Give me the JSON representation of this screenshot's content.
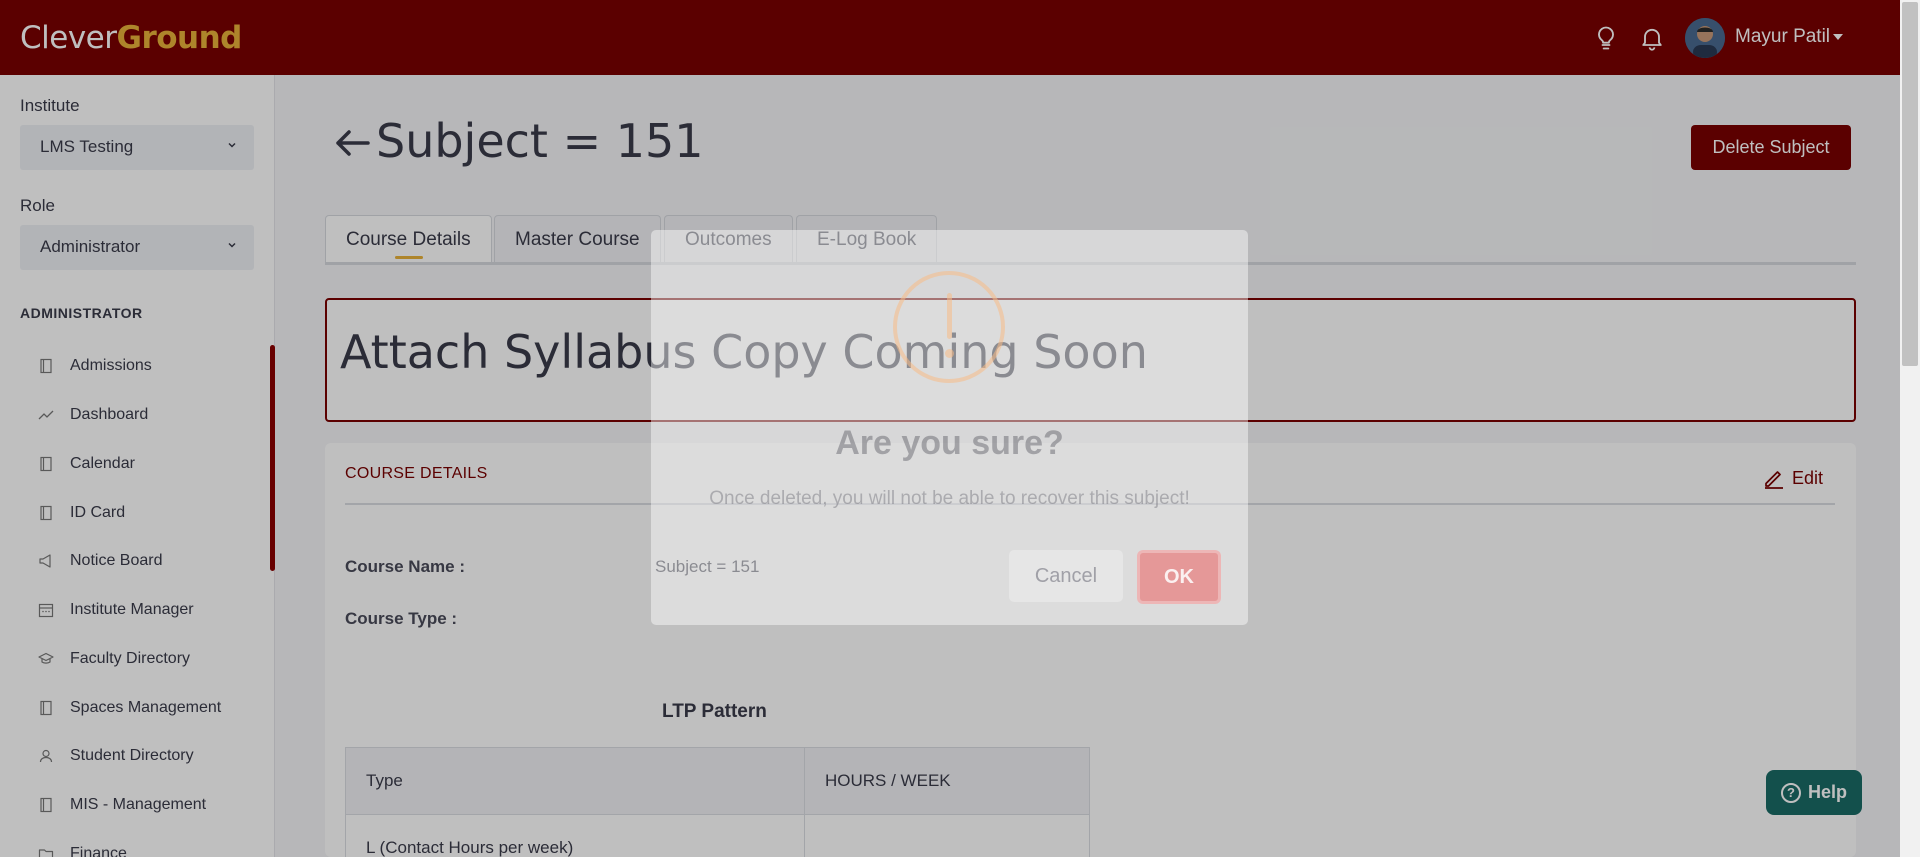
{
  "header": {
    "logo_part1": "Clever",
    "logo_part2": "Ground",
    "user_name": "Mayur Patil",
    "icons": [
      "lightbulb-icon",
      "bell-icon"
    ]
  },
  "sidebar": {
    "institute_label": "Institute",
    "institute_value": "LMS Testing",
    "role_label": "Role",
    "role_value": "Administrator",
    "section_heading": "ADMINISTRATOR",
    "items": [
      {
        "label": "Admissions",
        "icon": "book-icon"
      },
      {
        "label": "Dashboard",
        "icon": "trend-line-icon"
      },
      {
        "label": "Calendar",
        "icon": "book-icon"
      },
      {
        "label": "ID Card",
        "icon": "book-icon"
      },
      {
        "label": "Notice Board",
        "icon": "megaphone-icon"
      },
      {
        "label": "Institute Manager",
        "icon": "calendar-grid-icon"
      },
      {
        "label": "Faculty Directory",
        "icon": "graduation-cap-icon"
      },
      {
        "label": "Spaces Management",
        "icon": "book-icon"
      },
      {
        "label": "Student Directory",
        "icon": "users-icon"
      },
      {
        "label": "MIS - Management",
        "icon": "book-icon"
      },
      {
        "label": "Finance",
        "icon": "folder-icon"
      }
    ]
  },
  "main": {
    "title": "Subject = 151",
    "delete_label": "Delete Subject",
    "tabs": [
      {
        "label": "Course Details"
      },
      {
        "label": "Master Course"
      },
      {
        "label": "Outcomes"
      },
      {
        "label": "E-Log Book"
      }
    ],
    "syllabus_text": "Attach Syllabus Copy Coming Soon",
    "card": {
      "title": "COURSE DETAILS",
      "edit_label": "Edit",
      "fields": [
        {
          "label": "Course Name :",
          "value": "Subject = 151"
        },
        {
          "label": "Course Type :",
          "value": ""
        }
      ],
      "ltp_title": "LTP Pattern",
      "ltp_headers": [
        "Type",
        "HOURS / WEEK"
      ],
      "ltp_rows": [
        [
          "L (Contact Hours per week)",
          ""
        ]
      ]
    },
    "help_label": "Help"
  },
  "modal": {
    "title": "Are you sure?",
    "text": "Once deleted, you will not be able to recover this subject!",
    "cancel_label": "Cancel",
    "ok_label": "OK"
  },
  "colors": {
    "brand": "#7a0000",
    "accent": "#e8b23a",
    "help": "#1a6b66"
  }
}
